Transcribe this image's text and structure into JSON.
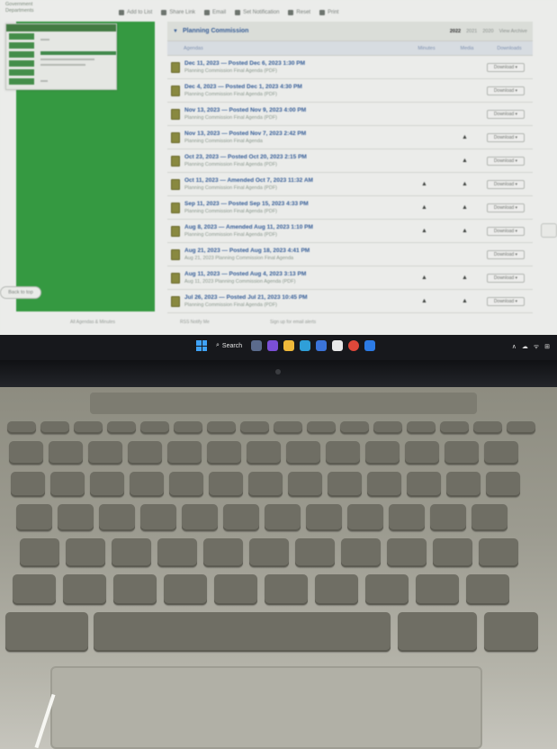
{
  "toolbar": {
    "items": [
      "Add to List",
      "Share Link",
      "Email",
      "Set Notification",
      "Reset",
      "Print"
    ]
  },
  "left_header": {
    "line1": "Government",
    "line2": "Departments"
  },
  "side_button": "Back to top",
  "section": {
    "title": "Planning Commission",
    "years": [
      "2022",
      "2021",
      "2020",
      "View Archive"
    ],
    "current_year": "2022"
  },
  "columns": {
    "name": "Agendas",
    "a": "Minutes",
    "b": "Media",
    "c": "Downloads"
  },
  "rows": [
    {
      "title": "Dec 11, 2023 — Posted Dec 6, 2023 1:30 PM",
      "sub": "Planning Commission Final Agenda (PDF)",
      "a": "",
      "b": "",
      "dl": "Download ▾"
    },
    {
      "title": "Dec 4, 2023 — Posted Dec 1, 2023 4:30 PM",
      "sub": "Planning Commission Final Agenda (PDF)",
      "a": "",
      "b": "",
      "dl": "Download ▾"
    },
    {
      "title": "Nov 13, 2023 — Posted Nov 9, 2023 4:00 PM",
      "sub": "Planning Commission Final Agenda (PDF)",
      "a": "",
      "b": "",
      "dl": "Download ▾"
    },
    {
      "title": "Nov 13, 2023 — Posted Nov 7, 2023 2:42 PM",
      "sub": "Planning Commission Final Agenda",
      "a": "",
      "b": "▲",
      "dl": "Download ▾"
    },
    {
      "title": "Oct 23, 2023 — Posted Oct 20, 2023 2:15 PM",
      "sub": "Planning Commission Final Agenda (PDF)",
      "a": "",
      "b": "▲",
      "dl": "Download ▾"
    },
    {
      "title": "Oct 11, 2023 — Amended Oct 7, 2023 11:32 AM",
      "sub": "Planning Commission Final Agenda (PDF)",
      "a": "▲",
      "b": "▲",
      "dl": "Download ▾"
    },
    {
      "title": "Sep 11, 2023 — Posted Sep 15, 2023 4:33 PM",
      "sub": "Planning Commission Final Agenda (PDF)",
      "a": "▲",
      "b": "▲",
      "dl": "Download ▾"
    },
    {
      "title": "Aug 8, 2023 — Amended Aug 11, 2023 1:10 PM",
      "sub": "Planning Commission Final Agenda (PDF)",
      "a": "▲",
      "b": "▲",
      "dl": "Download ▾"
    },
    {
      "title": "Aug 21, 2023 — Posted Aug 18, 2023 4:41 PM",
      "sub": "Aug 21, 2023 Planning Commission Final Agenda",
      "a": "",
      "b": "",
      "dl": "Download ▾"
    },
    {
      "title": "Aug 11, 2023 — Posted Aug 4, 2023 3:13 PM",
      "sub": "Aug 11, 2023 Planning Commission Agenda (PDF)",
      "a": "▲",
      "b": "▲",
      "dl": "Download ▾"
    },
    {
      "title": "Jul 26, 2023 — Posted Jul 21, 2023 10:45 PM",
      "sub": "Planning Commission Final Agenda (PDF)",
      "a": "▲",
      "b": "▲",
      "dl": "Download ▾"
    }
  ],
  "bottom_strip": [
    "All Agendas & Minutes",
    "RSS Notify Me",
    "Sign up for email alerts"
  ],
  "taskbar": {
    "search_label": "Search",
    "tray": "∧ ☁ ᯤ ⊞"
  }
}
